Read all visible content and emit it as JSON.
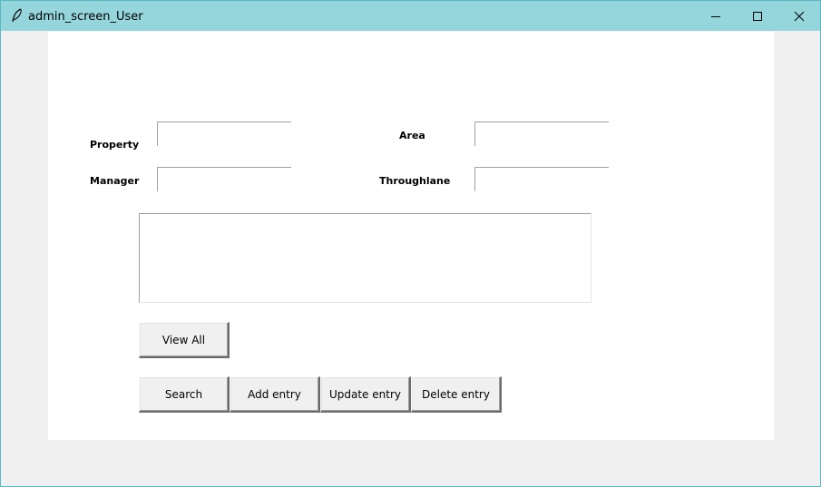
{
  "window": {
    "title": "admin_screen_User",
    "controls": {
      "minimize_icon": "minimize-icon",
      "maximize_icon": "maximize-icon",
      "close_icon": "close-icon"
    }
  },
  "form": {
    "property_label": "Property",
    "area_label": "Area",
    "manager_label": "Manager",
    "throughlane_label": "Throughlane",
    "property_value": "",
    "area_value": "",
    "manager_value": "",
    "throughlane_value": ""
  },
  "buttons": {
    "view_all": "View All",
    "search": "Search",
    "add_entry": "Add entry",
    "update_entry": "Update entry",
    "delete_entry": "Delete entry"
  }
}
